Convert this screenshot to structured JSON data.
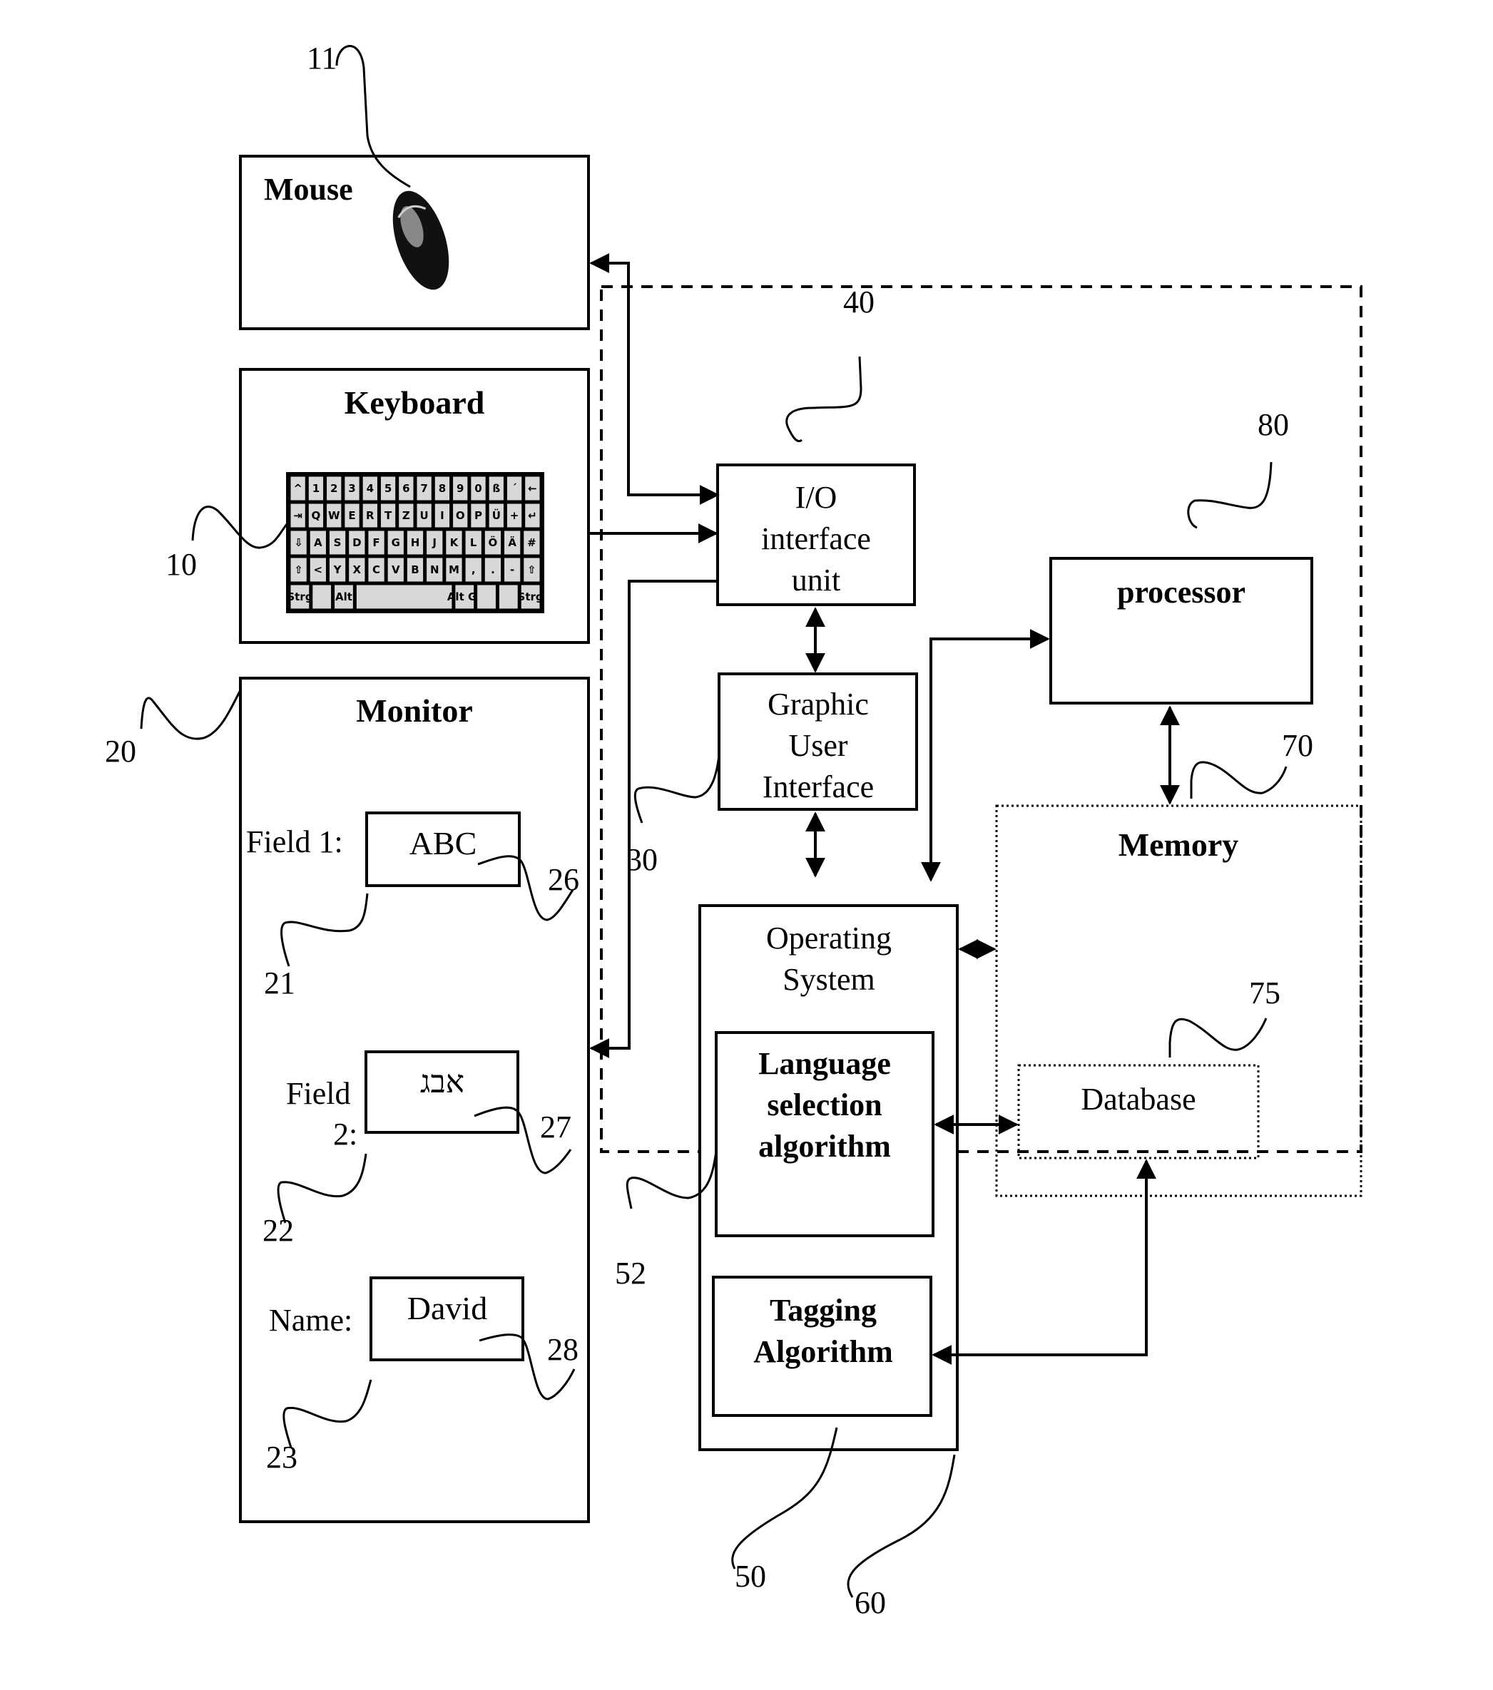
{
  "figure": {
    "blocks": {
      "mouse": {
        "label": "Mouse",
        "ref": "11"
      },
      "keyboard": {
        "label": "Keyboard",
        "ref": "10"
      },
      "monitor": {
        "label": "Monitor",
        "ref": "20"
      },
      "io_unit": {
        "lines": [
          "I/O",
          "interface",
          "unit"
        ],
        "ref": "40"
      },
      "gui": {
        "lines": [
          "Graphic",
          "User",
          "Interface"
        ],
        "ref": "30"
      },
      "os": {
        "lines": [
          "Operating",
          "System"
        ],
        "ref": "60"
      },
      "language_selection": {
        "lines": [
          "Language",
          "selection",
          "algorithm"
        ],
        "ref": "52"
      },
      "tagging": {
        "lines": [
          "Tagging",
          "Algorithm"
        ],
        "ref": "50"
      },
      "processor": {
        "label": "processor",
        "ref": "80"
      },
      "memory": {
        "label": "Memory",
        "ref": "70"
      },
      "database": {
        "label": "Database",
        "ref": "75"
      }
    },
    "monitor_fields": [
      {
        "label": "Field 1:",
        "value": "ABC",
        "field_ref": "21",
        "value_ref": "26"
      },
      {
        "label_line1": "Field",
        "label_line2": "2:",
        "value": "אבג",
        "field_ref": "22",
        "value_ref": "27"
      },
      {
        "label": "Name:",
        "value": "David",
        "field_ref": "23",
        "value_ref": "28"
      }
    ],
    "keyboard_keys": {
      "row1": [
        "^",
        "1",
        "2",
        "3",
        "4",
        "5",
        "6",
        "7",
        "8",
        "9",
        "0",
        "ß",
        "´",
        "←"
      ],
      "row2": [
        "⇥",
        "Q",
        "W",
        "E",
        "R",
        "T",
        "Z",
        "U",
        "I",
        "O",
        "P",
        "Ü",
        "+",
        "↵"
      ],
      "row3": [
        "⇩",
        "A",
        "S",
        "D",
        "F",
        "G",
        "H",
        "J",
        "K",
        "L",
        "Ö",
        "Ä",
        "#"
      ],
      "row4": [
        "⇧",
        "<",
        "Y",
        "X",
        "C",
        "V",
        "B",
        "N",
        "M",
        ",",
        ".",
        "-",
        "⇧"
      ],
      "row5": [
        "Strg",
        "",
        "Alt",
        "",
        "Alt Gr",
        "",
        "",
        "Strg"
      ]
    }
  }
}
